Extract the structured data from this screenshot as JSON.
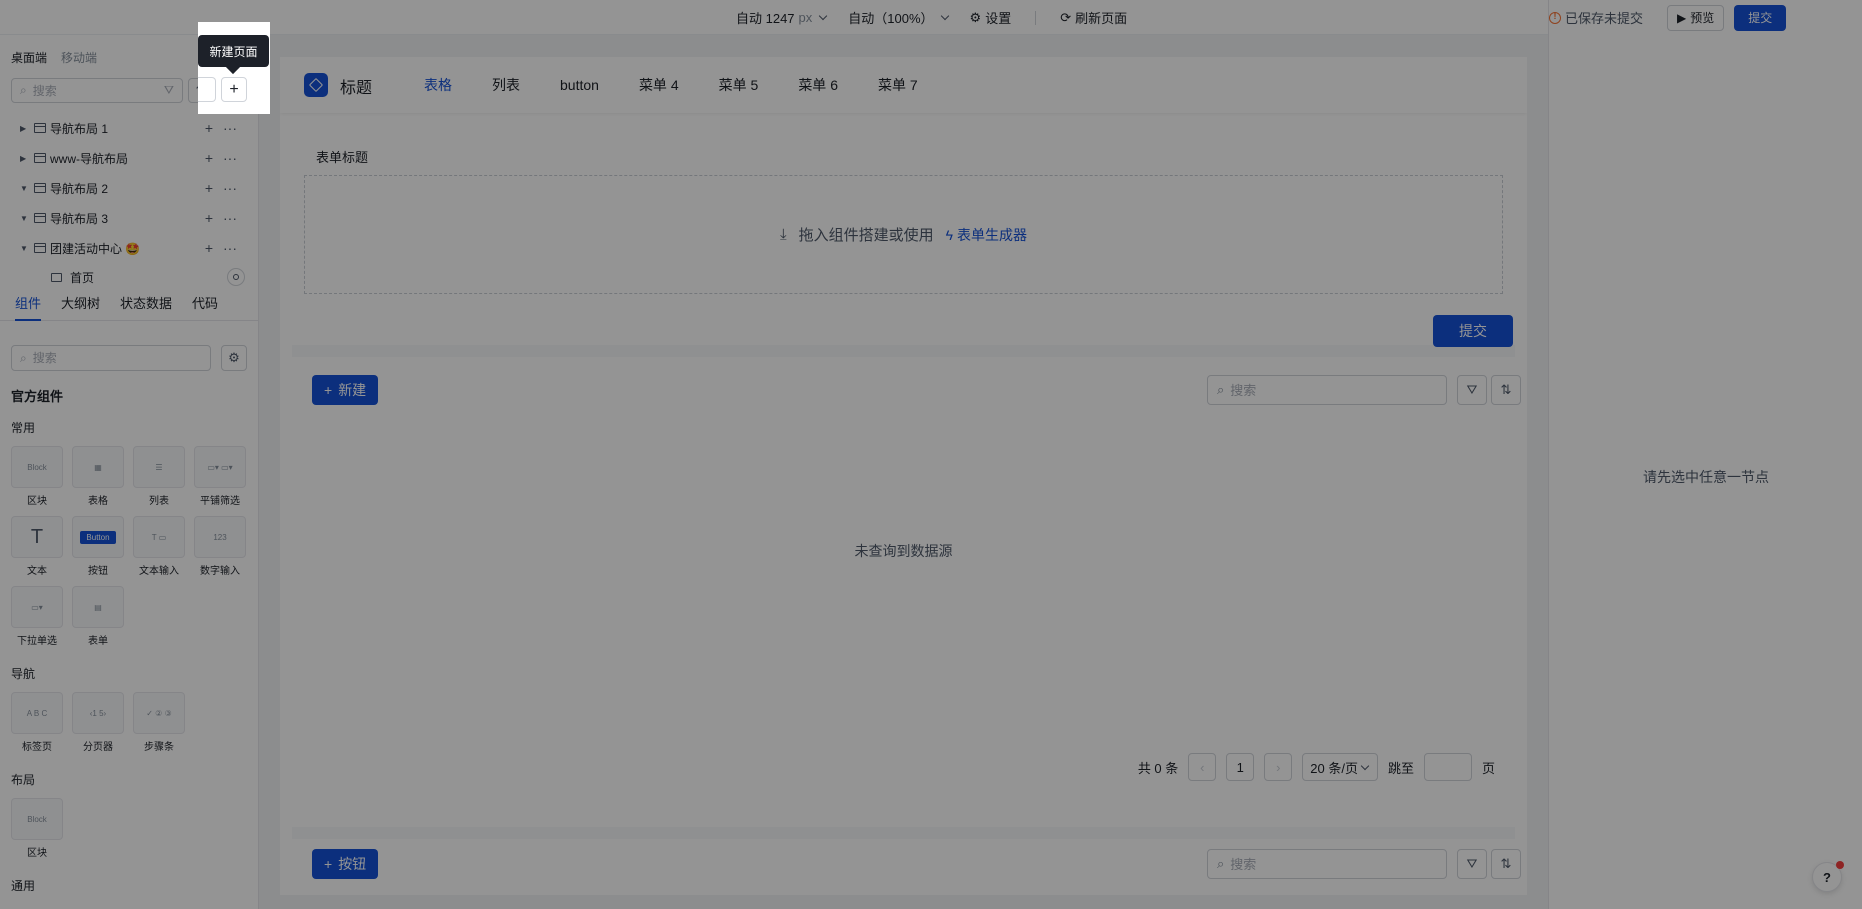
{
  "topbar": {
    "width_label": "自动 1247",
    "width_unit": "px",
    "zoom_label": "自动（100%）",
    "settings_label": "设置",
    "refresh_label": "刷新页面",
    "save_status": "已保存未提交",
    "preview_label": "预览",
    "submit_label": "提交"
  },
  "left": {
    "device_tabs": [
      "桌面端",
      "移动端"
    ],
    "search_placeholder": "搜索",
    "tree": [
      {
        "label": "导航布局 1",
        "expanded": false
      },
      {
        "label": "www-导航布局",
        "expanded": false
      },
      {
        "label": "导航布局 2",
        "expanded": true
      },
      {
        "label": "导航布局 3",
        "expanded": true
      },
      {
        "label": "团建活动中心 🤩",
        "expanded": true
      }
    ],
    "tree_child": "首页",
    "panel_tabs": [
      "组件",
      "大纲树",
      "状态数据",
      "代码"
    ],
    "component_search_placeholder": "搜索",
    "official_title": "官方组件",
    "groups": {
      "common": "常用",
      "nav": "导航",
      "layout": "布局",
      "general": "通用"
    },
    "components_common": [
      "区块",
      "表格",
      "列表",
      "平铺筛选",
      "文本",
      "按钮",
      "文本输入",
      "数字输入",
      "下拉单选",
      "表单"
    ],
    "components_nav": [
      "标签页",
      "分页器",
      "步骤条"
    ],
    "components_layout": [
      "区块"
    ],
    "thumb_block": "Block",
    "thumb_button": "Button",
    "thumb_number": "123"
  },
  "canvas": {
    "brand": "标题",
    "menu": [
      "表格",
      "列表",
      "button",
      "菜单 4",
      "菜单 5",
      "菜单 6",
      "菜单 7"
    ],
    "form_title": "表单标题",
    "drop_text": "拖入组件搭建或使用",
    "form_generator": "表单生成器",
    "form_submit": "提交",
    "new_button": "新建",
    "table_search_placeholder": "搜索",
    "empty_text": "未查询到数据源",
    "total": "共 0 条",
    "page_number": "1",
    "page_size": "20 条/页",
    "jump_label": "跳至",
    "page_suffix": "页",
    "bottom_button": "按钮",
    "bottom_search_placeholder": "搜索"
  },
  "right": {
    "hint": "请先选中任意一节点"
  },
  "tooltip": {
    "text": "新建页面"
  },
  "colors": {
    "primary": "#1652d8",
    "overlay": "rgba(0,0,0,0.42)",
    "warning": "#f77234"
  }
}
